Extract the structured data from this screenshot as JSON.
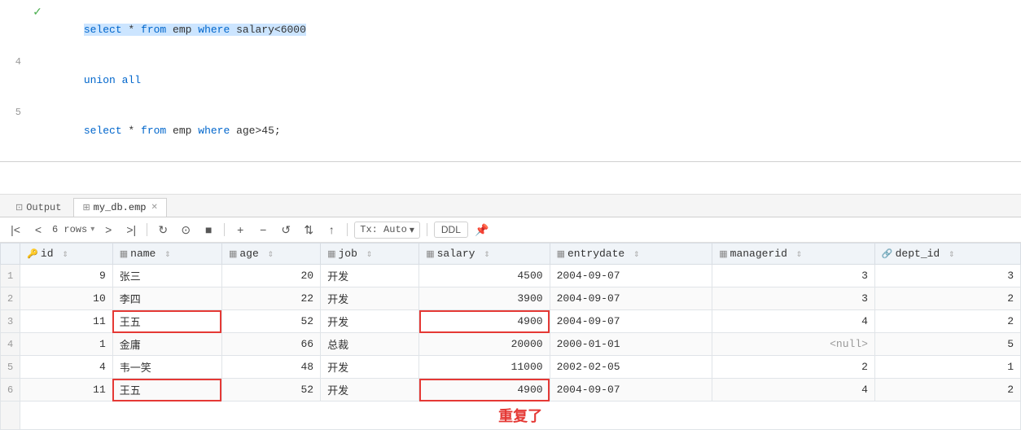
{
  "editor": {
    "lines": [
      {
        "num": "",
        "icon": "✓",
        "icon_class": "green",
        "content": "select * from emp where salary<6000",
        "has_selection": true,
        "selection_text": "select * from emp where salary<6000"
      },
      {
        "num": "4",
        "icon": "",
        "icon_class": "",
        "content": "union all",
        "has_selection": false
      },
      {
        "num": "5",
        "icon": "",
        "icon_class": "",
        "content": "select * from emp where age>45;",
        "has_selection": false
      }
    ]
  },
  "tabs": {
    "output": {
      "label": "Output",
      "icon": "⊡"
    },
    "table": {
      "label": "my_db.emp",
      "icon": "⊞",
      "closeable": true
    }
  },
  "toolbar": {
    "rows_label": "6 rows",
    "tx_label": "Tx: Auto",
    "ddl_label": "DDL"
  },
  "table": {
    "columns": [
      {
        "name": "id",
        "icon": "🔑",
        "type": "key"
      },
      {
        "name": "name",
        "icon": "▦"
      },
      {
        "name": "age",
        "icon": "▦"
      },
      {
        "name": "job",
        "icon": "▦"
      },
      {
        "name": "salary",
        "icon": "▦"
      },
      {
        "name": "entrydate",
        "icon": "▦"
      },
      {
        "name": "managerid",
        "icon": "▦"
      },
      {
        "name": "dept_id",
        "icon": "🔗"
      }
    ],
    "rows": [
      {
        "row_num": 1,
        "id": "9",
        "name": "张三",
        "age": "20",
        "job": "开发",
        "salary": "4500",
        "entrydate": "2004-09-07",
        "managerid": "3",
        "dept_id": "3",
        "highlight": false
      },
      {
        "row_num": 2,
        "id": "10",
        "name": "李四",
        "age": "22",
        "job": "开发",
        "salary": "3900",
        "entrydate": "2004-09-07",
        "managerid": "3",
        "dept_id": "2",
        "highlight": false
      },
      {
        "row_num": 3,
        "id": "11",
        "name": "王五",
        "age": "52",
        "job": "开发",
        "salary": "4900",
        "entrydate": "2004-09-07",
        "managerid": "4",
        "dept_id": "2",
        "highlight": true
      },
      {
        "row_num": 4,
        "id": "1",
        "name": "金庸",
        "age": "66",
        "job": "总裁",
        "salary": "20000",
        "entrydate": "2000-01-01",
        "managerid": "<null>",
        "dept_id": "5",
        "highlight": false
      },
      {
        "row_num": 5,
        "id": "4",
        "name": "韦一笑",
        "age": "48",
        "job": "开发",
        "salary": "11000",
        "entrydate": "2002-02-05",
        "managerid": "2",
        "dept_id": "1",
        "highlight": false
      },
      {
        "row_num": 6,
        "id": "11",
        "name": "王五",
        "age": "52",
        "job": "开发",
        "salary": "4900",
        "entrydate": "2004-09-07",
        "managerid": "4",
        "dept_id": "2",
        "highlight": true
      }
    ],
    "annotation": "重复了"
  }
}
